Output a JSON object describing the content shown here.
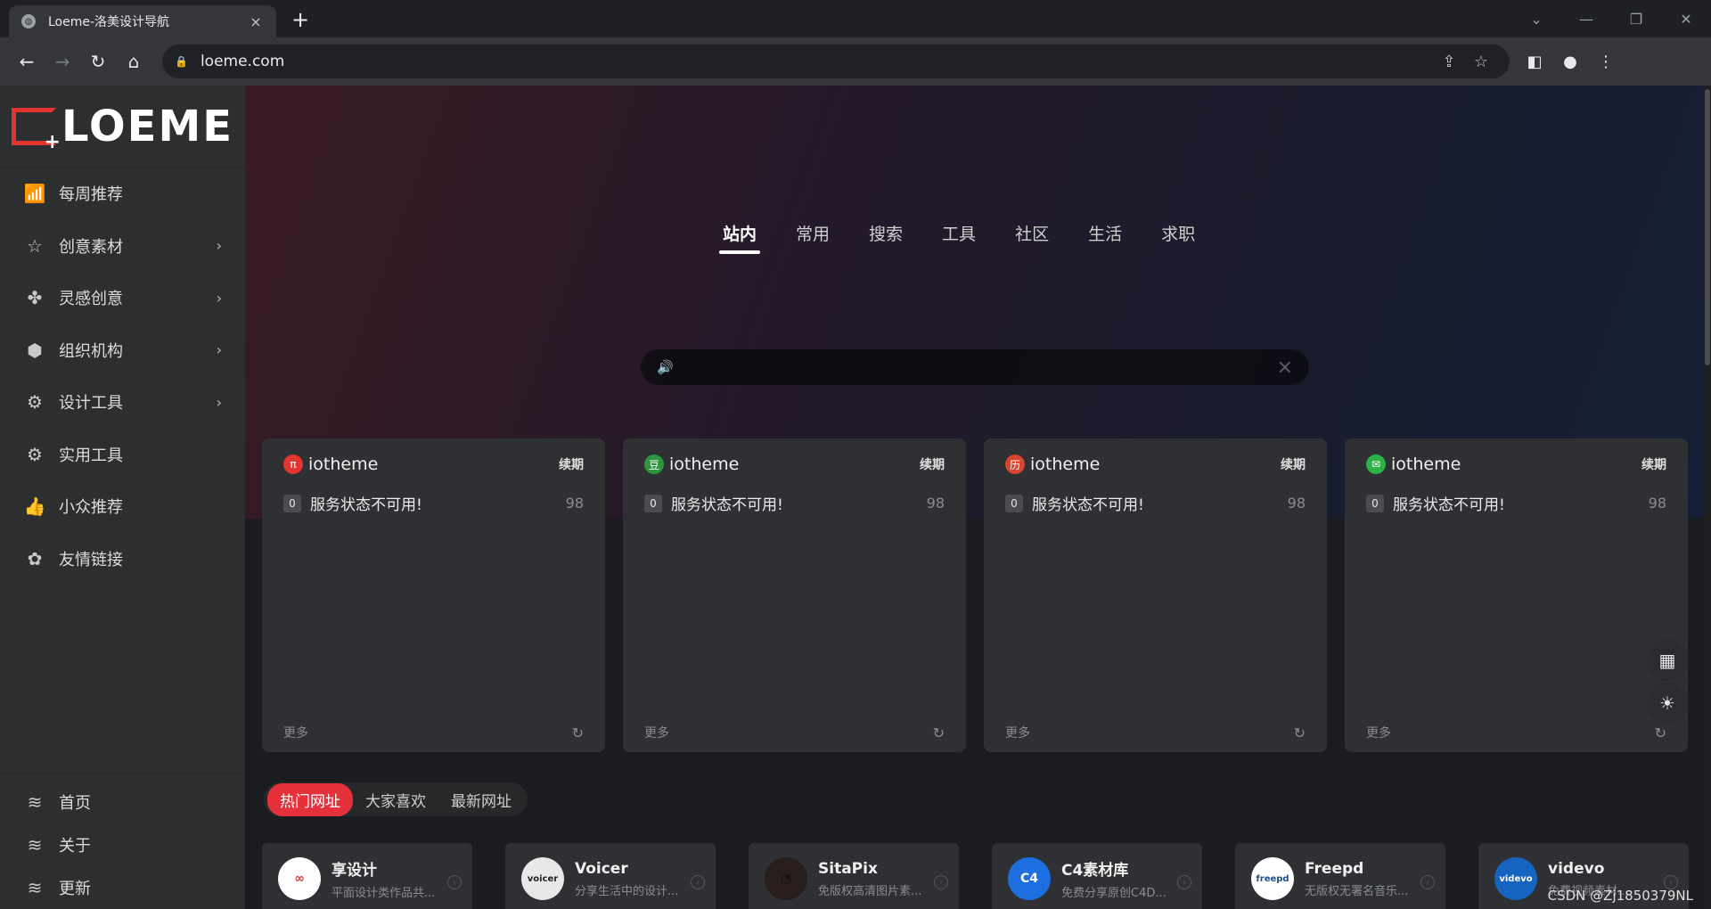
{
  "browser": {
    "tab_title": "Loeme-洛美设计导航",
    "tab_close": "×",
    "new_tab": "+",
    "url": "loeme.com",
    "window_controls": [
      "⌄",
      "—",
      "❐",
      "✕"
    ]
  },
  "sidebar": {
    "logo_text": "LOEME",
    "items": [
      {
        "label": "每周推荐",
        "icon": "chart-bars-icon",
        "glyph": "📶",
        "has_arrow": false
      },
      {
        "label": "创意素材",
        "icon": "star-icon",
        "glyph": "☆",
        "has_arrow": true
      },
      {
        "label": "灵感创意",
        "icon": "clover-icon",
        "glyph": "✤",
        "has_arrow": true
      },
      {
        "label": "组织机构",
        "icon": "cube-icon",
        "glyph": "⬢",
        "has_arrow": true
      },
      {
        "label": "设计工具",
        "icon": "gear-icon",
        "glyph": "⚙",
        "has_arrow": true
      },
      {
        "label": "实用工具",
        "icon": "gear-icon",
        "glyph": "⚙",
        "has_arrow": false
      },
      {
        "label": "小众推荐",
        "icon": "thumbs-up-icon",
        "glyph": "👍",
        "has_arrow": false
      },
      {
        "label": "友情链接",
        "icon": "users-icon",
        "glyph": "✿",
        "has_arrow": false
      }
    ],
    "arrow": "›",
    "bottom_items": [
      {
        "label": "首页",
        "icon": "layers-icon",
        "glyph": "≋"
      },
      {
        "label": "关于",
        "icon": "layers-icon",
        "glyph": "≋"
      },
      {
        "label": "更新",
        "icon": "layers-icon",
        "glyph": "≋"
      }
    ]
  },
  "search": {
    "tabs": [
      "站内",
      "常用",
      "搜索",
      "工具",
      "社区",
      "生活",
      "求职"
    ],
    "active_tab": 0,
    "placeholder": "",
    "value": ""
  },
  "cards": [
    {
      "title": "iotheme",
      "icon": "pi-icon",
      "glyph": "π",
      "icon_color": "#e3342f",
      "renew": "续期",
      "num": "0",
      "text": "服务状态不可用!",
      "count": "98",
      "more": "更多"
    },
    {
      "title": "iotheme",
      "icon": "douban-icon",
      "glyph": "豆",
      "icon_color": "#2e963d",
      "renew": "续期",
      "num": "0",
      "text": "服务状态不可用!",
      "count": "98",
      "more": "更多"
    },
    {
      "title": "iotheme",
      "icon": "calendar-icon",
      "glyph": "历",
      "icon_color": "#d8452c",
      "renew": "续期",
      "num": "0",
      "text": "服务状态不可用!",
      "count": "98",
      "more": "更多"
    },
    {
      "title": "iotheme",
      "icon": "wechat-icon",
      "glyph": "✉",
      "icon_color": "#2ab245",
      "renew": "续期",
      "num": "0",
      "text": "服务状态不可用!",
      "count": "98",
      "more": "更多"
    }
  ],
  "hot_tabs": [
    "热门网址",
    "大家喜欢",
    "最新网址"
  ],
  "hot_active": 0,
  "sites": [
    {
      "name": "享设计",
      "desc": "平面设计类作品共...",
      "logo": "∞",
      "logo_bg": "#ffffff",
      "logo_fg": "#e3342f"
    },
    {
      "name": "Voicer",
      "desc": "分享生活中的设计...",
      "logo": "voicer",
      "logo_bg": "#e8e8e8",
      "logo_fg": "#222222"
    },
    {
      "name": "SitaPix",
      "desc": "免版权高清图片素...",
      "logo": "◔",
      "logo_bg": "#2a1e1c",
      "logo_fg": "#111111"
    },
    {
      "name": "C4素材库",
      "desc": "免费分享原创C4D...",
      "logo": "C4",
      "logo_bg": "#1d6fe0",
      "logo_fg": "#ffffff"
    },
    {
      "name": "Freepd",
      "desc": "无版权无署名音乐...",
      "logo": "freepd",
      "logo_bg": "#ffffff",
      "logo_fg": "#1d4e89"
    },
    {
      "name": "videvo",
      "desc": "免费视频素材...",
      "logo": "videvo",
      "logo_bg": "#1565c0",
      "logo_fg": "#ffffff"
    }
  ],
  "watermark": "CSDN @Zj1850379NL"
}
